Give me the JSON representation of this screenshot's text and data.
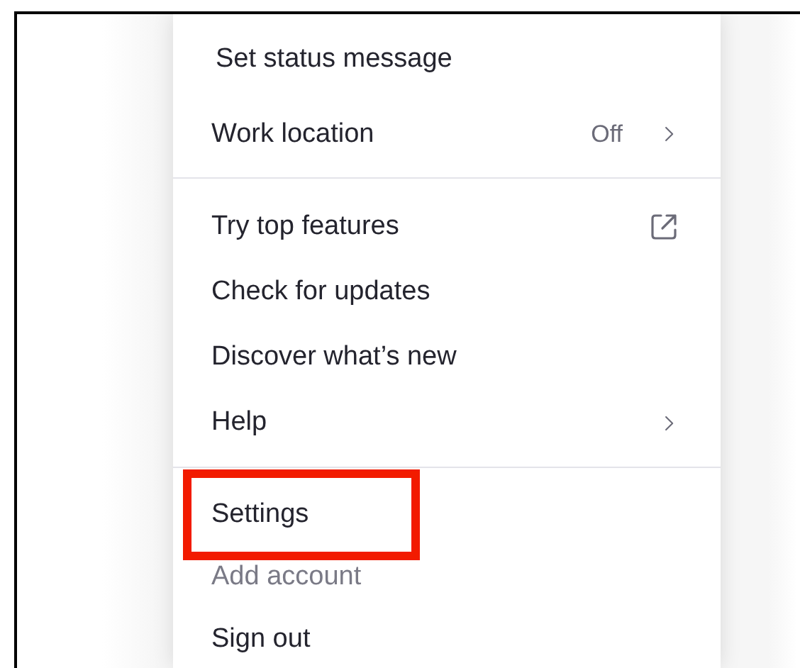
{
  "menu": {
    "sections": [
      {
        "items": [
          {
            "label": "Set status message",
            "kind": "plain",
            "disabled": false,
            "outlined": false
          },
          {
            "label": "Work location",
            "kind": "submenu",
            "value": "Off",
            "disabled": false,
            "outlined": false
          }
        ]
      },
      {
        "items": [
          {
            "label": "Try top features",
            "kind": "external",
            "disabled": false,
            "outlined": false
          },
          {
            "label": "Check for updates",
            "kind": "plain",
            "disabled": false,
            "outlined": false
          },
          {
            "label": "Discover what’s new",
            "kind": "plain",
            "disabled": false,
            "outlined": false
          },
          {
            "label": "Help",
            "kind": "submenu",
            "disabled": false,
            "outlined": false
          }
        ]
      },
      {
        "items": [
          {
            "label": "Settings",
            "kind": "plain",
            "disabled": false,
            "outlined": true
          },
          {
            "label": "Add account",
            "kind": "plain",
            "disabled": true,
            "outlined": false
          },
          {
            "label": "Sign out",
            "kind": "plain",
            "disabled": false,
            "outlined": false
          }
        ]
      }
    ]
  }
}
